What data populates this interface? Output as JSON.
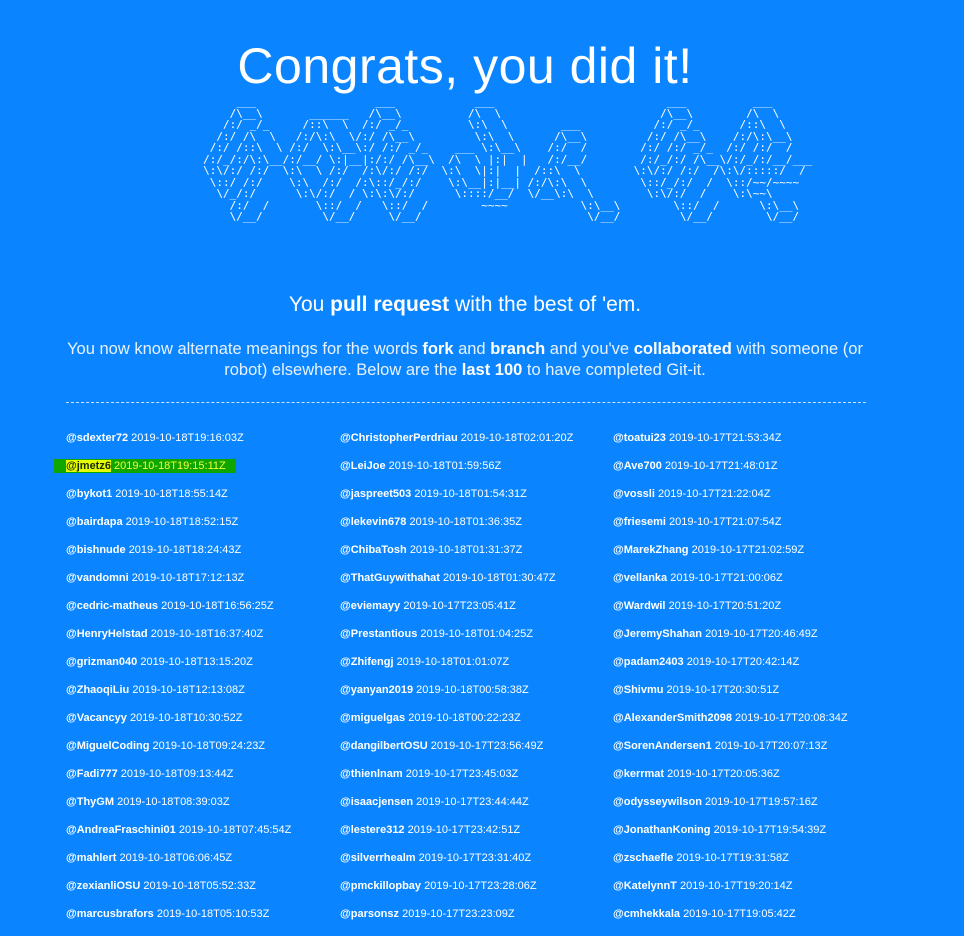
{
  "header": {
    "title": "Congrats, you did it!"
  },
  "ascii_art": "          ___                  ___            ___                          ___          ___\n         /\\__\\       ______   /\\__\\          /\\  \\                        /\\__\\        /\\  \\\n        /:/ _/_     /::\\  \\  /:/ _/_         \\:\\  \\        ___           /:/ _/_      /::\\  \\\n       /:/ /\\  \\   /:/\\:\\  \\/:/ /\\__\\         \\:\\  \\      /\\__\\         /:/ /\\__\\    /:/\\:\\__\\\n      /:/ /::\\  \\ /:/  \\:\\__\\:/ /:/ _/_    ___ \\:\\__\\    /:/  /        /:/ /:/ _/_  /:/ /:/  /\n     /:/_/:/\\:\\__/:/__/ \\:|__|:/:/ /\\__\\  /\\  \\ |:|  |   /:/__/        /:/_/:/ /\\__\\/:/_/:/__/___\n     \\:\\/:/ /:/  \\:\\  \\ /:/  /:\\/:/ /:/  \\:\\  \\|:|  |  /::\\  \\        \\:\\/:/ /:/  /\\:\\/:::::/  /\n      \\::/ /:/    \\:\\  /:/  /:\\::/_/:/    \\:\\__|:|__| /:/\\:\\  \\        \\::/_/:/  /  \\::/~~/~~~~\n       \\/_/:/      \\:\\/:/  / \\:\\:\\/:/      \\::::/__/  \\/__\\:\\  \\        \\:\\/:/  /    \\:\\~~\\\n         /:/  /       \\::/  /   \\::/  /        ~~~~           \\:\\__\\        \\::/  /      \\:\\__\\\n         \\/__/         \\/__/     \\/__/                         \\/__/         \\/__/        \\/__/",
  "tagline": {
    "prefix": "You ",
    "bold": "pull request",
    "suffix": " with the best of 'em."
  },
  "description": {
    "t1": "You now know alternate meanings for the words ",
    "b1": "fork",
    "t2": " and ",
    "b2": "branch",
    "t3": " and you've ",
    "b3": "collaborated",
    "t4": " with someone (or robot) elsewhere. Below are the ",
    "b4": "last 100",
    "t5": " to have completed Git-it."
  },
  "completions": {
    "col1": [
      {
        "user": "@sdexter72",
        "time": "2019-10-18T19:16:03Z"
      },
      {
        "user": "@jmetz6",
        "time": "2019-10-18T19:15:11Z"
      },
      {
        "user": "@bykot1",
        "time": "2019-10-18T18:55:14Z"
      },
      {
        "user": "@bairdapa",
        "time": "2019-10-18T18:52:15Z"
      },
      {
        "user": "@bishnude",
        "time": "2019-10-18T18:24:43Z"
      },
      {
        "user": "@vandomni",
        "time": "2019-10-18T17:12:13Z"
      },
      {
        "user": "@cedric-matheus",
        "time": "2019-10-18T16:56:25Z"
      },
      {
        "user": "@HenryHelstad",
        "time": "2019-10-18T16:37:40Z"
      },
      {
        "user": "@grizman040",
        "time": "2019-10-18T13:15:20Z"
      },
      {
        "user": "@ZhaoqiLiu",
        "time": "2019-10-18T12:13:08Z"
      },
      {
        "user": "@Vacancyy",
        "time": "2019-10-18T10:30:52Z"
      },
      {
        "user": "@MiguelCoding",
        "time": "2019-10-18T09:24:23Z"
      },
      {
        "user": "@Fadi777",
        "time": "2019-10-18T09:13:44Z"
      },
      {
        "user": "@ThyGM",
        "time": "2019-10-18T08:39:03Z"
      },
      {
        "user": "@AndreaFraschini01",
        "time": "2019-10-18T07:45:54Z"
      },
      {
        "user": "@mahlert",
        "time": "2019-10-18T06:06:45Z"
      },
      {
        "user": "@zexianliOSU",
        "time": "2019-10-18T05:52:33Z"
      },
      {
        "user": "@marcusbrafors",
        "time": "2019-10-18T05:10:53Z"
      }
    ],
    "col2": [
      {
        "user": "@ChristopherPerdriau",
        "time": "2019-10-18T02:01:20Z"
      },
      {
        "user": "@LeiJoe",
        "time": "2019-10-18T01:59:56Z"
      },
      {
        "user": "@jaspreet503",
        "time": "2019-10-18T01:54:31Z"
      },
      {
        "user": "@lekevin678",
        "time": "2019-10-18T01:36:35Z"
      },
      {
        "user": "@ChibaTosh",
        "time": "2019-10-18T01:31:37Z"
      },
      {
        "user": "@ThatGuywithahat",
        "time": "2019-10-18T01:30:47Z"
      },
      {
        "user": "@eviemayy",
        "time": "2019-10-17T23:05:41Z"
      },
      {
        "user": "@Prestantious",
        "time": "2019-10-18T01:04:25Z"
      },
      {
        "user": "@Zhifengj",
        "time": "2019-10-18T01:01:07Z"
      },
      {
        "user": "@yanyan2019",
        "time": "2019-10-18T00:58:38Z"
      },
      {
        "user": "@miguelgas",
        "time": "2019-10-18T00:22:23Z"
      },
      {
        "user": "@dangilbertOSU",
        "time": "2019-10-17T23:56:49Z"
      },
      {
        "user": "@thienlnam",
        "time": "2019-10-17T23:45:03Z"
      },
      {
        "user": "@isaacjensen",
        "time": "2019-10-17T23:44:44Z"
      },
      {
        "user": "@lestere312",
        "time": "2019-10-17T23:42:51Z"
      },
      {
        "user": "@silverrhealm",
        "time": "2019-10-17T23:31:40Z"
      },
      {
        "user": "@pmckillopbay",
        "time": "2019-10-17T23:28:06Z"
      },
      {
        "user": "@parsonsz",
        "time": "2019-10-17T23:23:09Z"
      }
    ],
    "col3": [
      {
        "user": "@toatui23",
        "time": "2019-10-17T21:53:34Z"
      },
      {
        "user": "@Ave700",
        "time": "2019-10-17T21:48:01Z"
      },
      {
        "user": "@vossli",
        "time": "2019-10-17T21:22:04Z"
      },
      {
        "user": "@friesemi",
        "time": "2019-10-17T21:07:54Z"
      },
      {
        "user": "@MarekZhang",
        "time": "2019-10-17T21:02:59Z"
      },
      {
        "user": "@vellanka",
        "time": "2019-10-17T21:00:06Z"
      },
      {
        "user": "@Wardwil",
        "time": "2019-10-17T20:51:20Z"
      },
      {
        "user": "@JeremyShahan",
        "time": "2019-10-17T20:46:49Z"
      },
      {
        "user": "@padam2403",
        "time": "2019-10-17T20:42:14Z"
      },
      {
        "user": "@Shivmu",
        "time": "2019-10-17T20:30:51Z"
      },
      {
        "user": "@AlexanderSmith2098",
        "time": "2019-10-17T20:08:34Z"
      },
      {
        "user": "@SorenAndersen1",
        "time": "2019-10-17T20:07:13Z"
      },
      {
        "user": "@kerrmat",
        "time": "2019-10-17T20:05:36Z"
      },
      {
        "user": "@odysseywilson",
        "time": "2019-10-17T19:57:16Z"
      },
      {
        "user": "@JonathanKoning",
        "time": "2019-10-17T19:54:39Z"
      },
      {
        "user": "@zschaefle",
        "time": "2019-10-17T19:31:58Z"
      },
      {
        "user": "@KatelynnT",
        "time": "2019-10-17T19:20:14Z"
      },
      {
        "user": "@cmhekkala",
        "time": "2019-10-17T19:05:42Z"
      }
    ]
  },
  "highlighted_user": "@jmetz6",
  "colors": {
    "background": "#0a85ff",
    "text": "#ffffff",
    "highlight_green": "#0fa600",
    "highlight_yellow": "#e6ff00"
  }
}
